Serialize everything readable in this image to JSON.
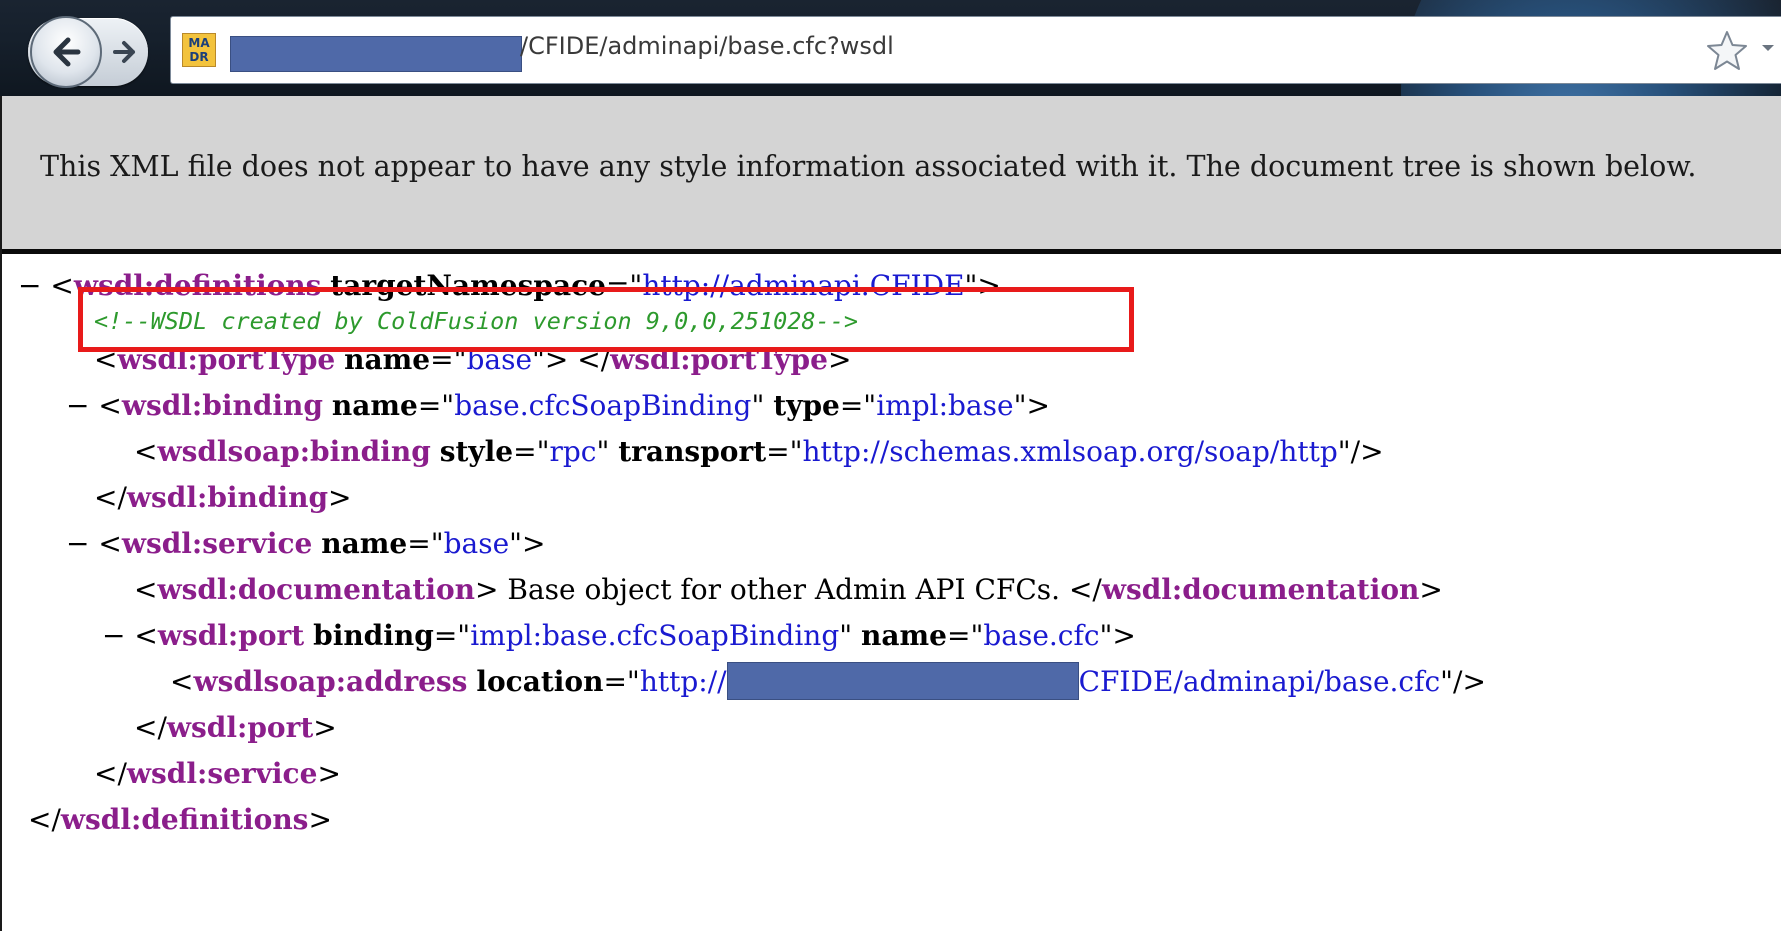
{
  "browser": {
    "url_suffix": "/CFIDE/adminapi/base.cfc?wsdl",
    "favicon_text": "MA DR",
    "icons": {
      "back": "back-arrow-icon",
      "forward": "forward-arrow-icon",
      "bookmark": "star-icon",
      "menu": "dropdown-arrow-icon"
    }
  },
  "info_message": "This XML file does not appear to have any style information associated with it. The document tree is shown below.",
  "xml": {
    "collapse_symbol": "−",
    "definitions_tag": "wsdl:definitions",
    "definitions_attr": "targetNamespace",
    "definitions_val": "http://adminapi.CFIDE",
    "comment": "<!--WSDL created by ColdFusion version 9,0,0,251028-->",
    "porttype_tag": "wsdl:portType",
    "porttype_attr": "name",
    "porttype_val": "base",
    "binding_tag": "wsdl:binding",
    "binding_attr1": "name",
    "binding_val1": "base.cfcSoapBinding",
    "binding_attr2": "type",
    "binding_val2": "impl:base",
    "soapbinding_tag": "wsdlsoap:binding",
    "soapbinding_attr1": "style",
    "soapbinding_val1": "rpc",
    "soapbinding_attr2": "transport",
    "soapbinding_val2": "http://schemas.xmlsoap.org/soap/http",
    "service_tag": "wsdl:service",
    "service_attr": "name",
    "service_val": "base",
    "documentation_tag": "wsdl:documentation",
    "documentation_text": " Base object for other Admin API CFCs. ",
    "port_tag": "wsdl:port",
    "port_attr1": "binding",
    "port_val1": "impl:base.cfcSoapBinding",
    "port_attr2": "name",
    "port_val2": "base.cfc",
    "address_tag": "wsdlsoap:address",
    "address_attr": "location",
    "address_val_prefix": "http://",
    "address_val_suffix": "CFIDE/adminapi/base.cfc"
  },
  "colors": {
    "tag": "#8b1e8b",
    "attribute_value": "#1a1ad0",
    "comment": "#2d9a2d",
    "highlight": "#e81a1a",
    "redaction": "#4f69a8"
  }
}
